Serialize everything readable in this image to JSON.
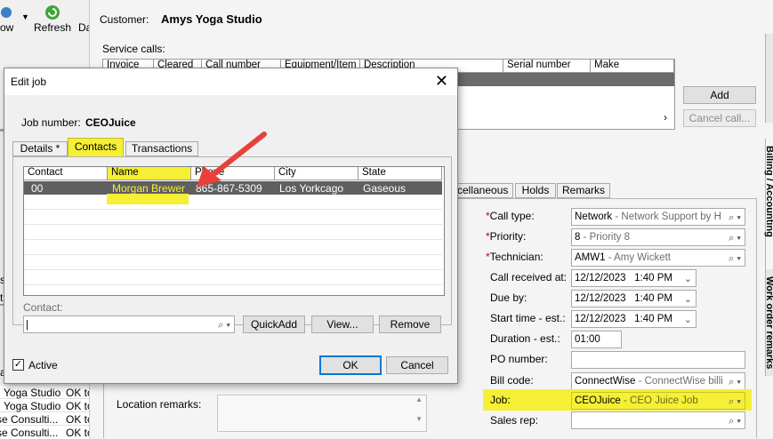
{
  "toolbar": {
    "now_label": "ow",
    "refresh_label": "Refresh",
    "cut_label": "Da"
  },
  "left_list": [
    {
      "name": "Yoga Studio",
      "val": "OK to"
    },
    {
      "name": "Yoga Studio",
      "val": "OK to"
    },
    {
      "name": "se Consulti...",
      "val": "OK to"
    },
    {
      "name": "se Consulti...",
      "val": "OK to"
    }
  ],
  "left_partial": [
    "s",
    "tl",
    "a"
  ],
  "customer": {
    "label": "Customer:",
    "value": "Amys Yoga Studio"
  },
  "service_calls": {
    "label": "Service calls:",
    "columns": [
      "Invoice",
      "Cleared",
      "Call number",
      "Equipment/Item",
      "Description",
      "Serial number",
      "Make"
    ],
    "add_label": "Add",
    "cancel_label": "Cancel call..."
  },
  "side_tabs": [
    "Billing / Accounting",
    "Work order remarks"
  ],
  "main_tabs": [
    "scellaneous",
    "Holds",
    "Remarks"
  ],
  "form": {
    "call_type": {
      "label": "Call type:",
      "code": "Network",
      "desc": "Network Support by H"
    },
    "priority": {
      "label": "Priority:",
      "code": "8",
      "desc": "Priority 8"
    },
    "technician": {
      "label": "Technician:",
      "code": "AMW1",
      "desc": "Amy Wickett"
    },
    "call_received": {
      "label": "Call received at:",
      "date": "12/12/2023",
      "time": "1:40 PM"
    },
    "due_by": {
      "label": "Due by:",
      "date": "12/12/2023",
      "time": "1:40 PM"
    },
    "start_time": {
      "label": "Start time - est.:",
      "date": "12/12/2023",
      "time": "1:40 PM"
    },
    "duration": {
      "label": "Duration - est.:",
      "value": "01:00"
    },
    "po_number": {
      "label": "PO number:",
      "value": ""
    },
    "bill_code": {
      "label": "Bill code:",
      "code": "ConnectWise",
      "desc": "ConnectWise billi"
    },
    "job": {
      "label": "Job:",
      "code": "CEOJuice",
      "desc": "CEO Juice Job"
    },
    "sales_rep": {
      "label": "Sales rep:",
      "value": ""
    }
  },
  "location_remarks_label": "Location remarks:",
  "dialog": {
    "title": "Edit job",
    "job_number_label": "Job number:",
    "job_number_value": "CEOJuice",
    "tabs": [
      "Details *",
      "Contacts",
      "Transactions"
    ],
    "grid_columns": [
      "Contact",
      "Name",
      "Phone",
      "City",
      "State"
    ],
    "row": {
      "contact": "00",
      "name": "Morgan Brewer",
      "phone": "865-867-5309",
      "city": "Los Yorkcago",
      "state": "Gaseous"
    },
    "contact_label": "Contact:",
    "contact_value": "",
    "quickadd_label": "QuickAdd",
    "view_label": "View...",
    "remove_label": "Remove",
    "active_label": "Active",
    "ok_label": "OK",
    "cancel_label": "Cancel"
  },
  "colors": {
    "highlight": "#f5ef36",
    "arrow": "#e8413c",
    "selected_row": "#5f5f5f",
    "required": "#c00000"
  }
}
